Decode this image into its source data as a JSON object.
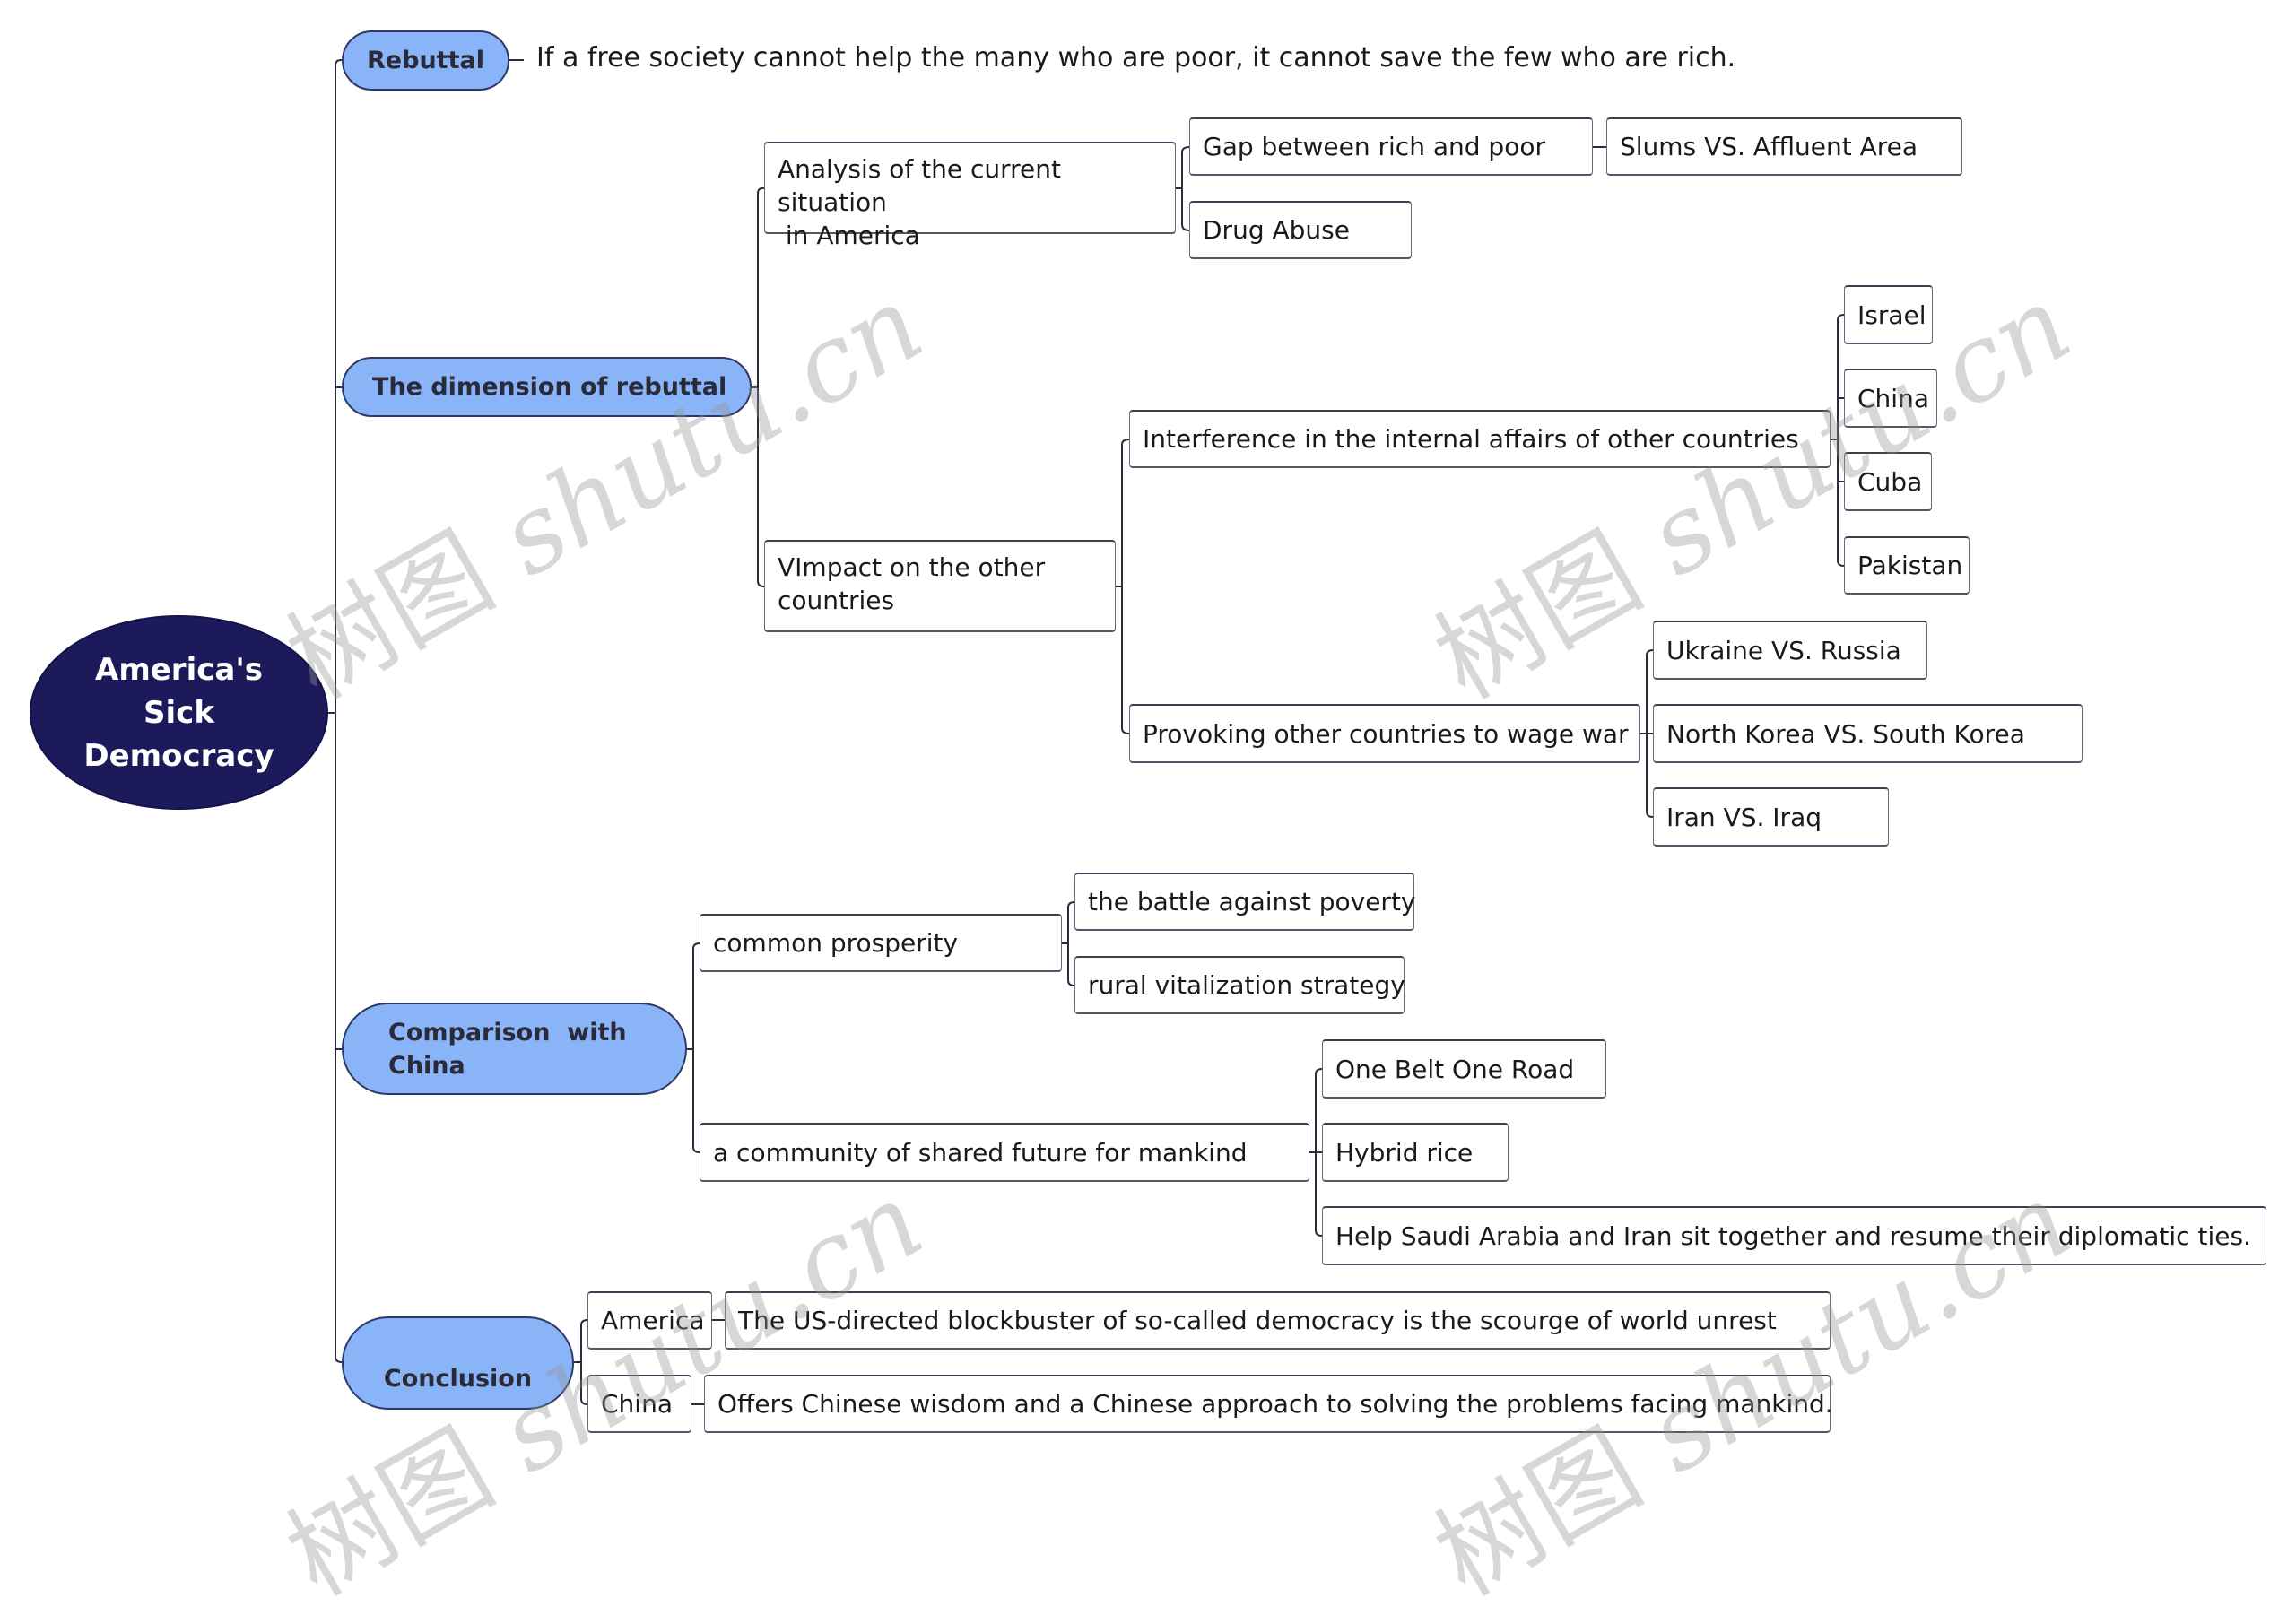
{
  "root": {
    "label": "America's Sick Democracy",
    "lines": [
      "America's",
      "Sick",
      "Democracy"
    ]
  },
  "branches": {
    "rebuttal": {
      "label": "Rebuttal",
      "quote": "If a free society cannot help the many who are poor, it cannot save the few who are rich."
    },
    "dimension": {
      "label": "The dimension of rebuttal",
      "analysis": {
        "label_line1": "Analysis of the current situation",
        "label_line2": " in America",
        "gap": "Gap between rich and poor",
        "slums": "Slums VS. Affluent Area",
        "drug": "Drug Abuse"
      },
      "impact": {
        "label_line1": "VImpact on the other",
        "label_line2": "countries",
        "interference": {
          "label": "Interference in the internal affairs of other countries",
          "countries": [
            "Israel",
            "China",
            "Cuba",
            "Pakistan"
          ]
        },
        "provoking": {
          "label": "Provoking other countries to wage war",
          "conflicts": [
            "Ukraine VS. Russia",
            "North Korea VS. South Korea",
            "Iran VS. Iraq"
          ]
        }
      }
    },
    "comparison": {
      "label_line1": "Comparison  with",
      "label_line2": "China",
      "prosperity": {
        "label": "common prosperity",
        "items": [
          "the battle against poverty",
          "rural vitalization strategy"
        ]
      },
      "community": {
        "label": "a community of shared future for mankind",
        "items": [
          "One Belt One Road",
          "Hybrid rice",
          "Help Saudi Arabia and Iran sit together and resume their diplomatic ties."
        ]
      }
    },
    "conclusion": {
      "label": "Conclusion",
      "america": {
        "label": "America",
        "text": "The US-directed blockbuster of so-called democracy is the scourge of world unrest"
      },
      "china": {
        "label": "China",
        "text": "Offers Chinese wisdom and a Chinese approach to solving the problems facing mankind."
      }
    }
  },
  "watermark": {
    "cn": "树图",
    "latin": "shutu.cn"
  },
  "colors": {
    "root_fill": "#1c1a5a",
    "branch_fill": "#8ab4f8",
    "line": "#2b2b3b",
    "text": "#1a1a1a"
  }
}
